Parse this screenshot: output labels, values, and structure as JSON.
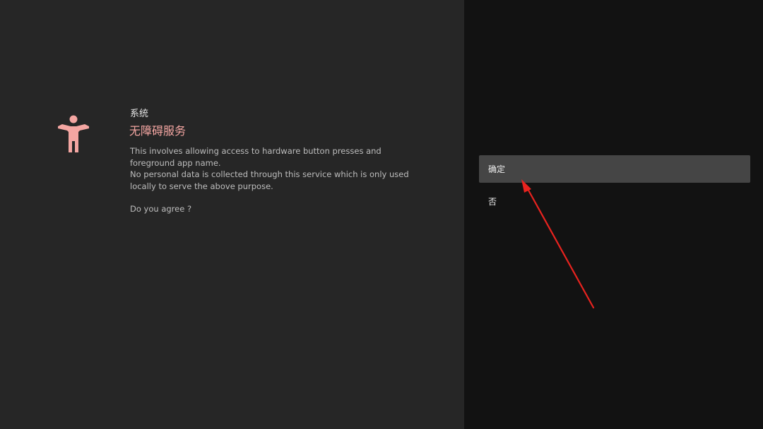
{
  "dialog": {
    "category": "系统",
    "title": "无障碍服务",
    "icon": "accessibility-icon",
    "description_lines": [
      "This involves allowing access to hardware button presses and foreground app name.",
      "No personal data is collected through this service which is only used locally to serve the above purpose."
    ],
    "question": "Do you agree ?"
  },
  "options": {
    "confirm_label": "确定",
    "deny_label": "否",
    "selected": "confirm"
  },
  "colors": {
    "accent": "#f4a6a2",
    "left_panel": "#262626",
    "right_panel": "#121212",
    "selected_option": "#454545",
    "annotation_arrow": "#e8231f"
  }
}
